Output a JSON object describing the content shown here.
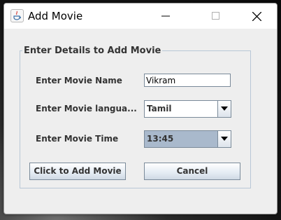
{
  "window": {
    "title": "Add Movie",
    "icon": "java-cup-icon",
    "controls": [
      "minimize-icon",
      "maximize-icon",
      "close-icon"
    ]
  },
  "form": {
    "group_title": "Enter Details to Add Movie",
    "movie_name_label": "Enter Movie Name",
    "movie_name_value": "Vikram",
    "language_label": "Enter Movie langua...",
    "language_selected": "Tamil",
    "time_label": "Enter Movie Time",
    "time_selected": "13:45"
  },
  "buttons": {
    "add_label": "Click to Add Movie",
    "cancel_label": "Cancel"
  },
  "colors": {
    "window_bg": "#eeeeee",
    "selected_combo_bg": "#a9b9cc",
    "border": "#7a8a99"
  }
}
